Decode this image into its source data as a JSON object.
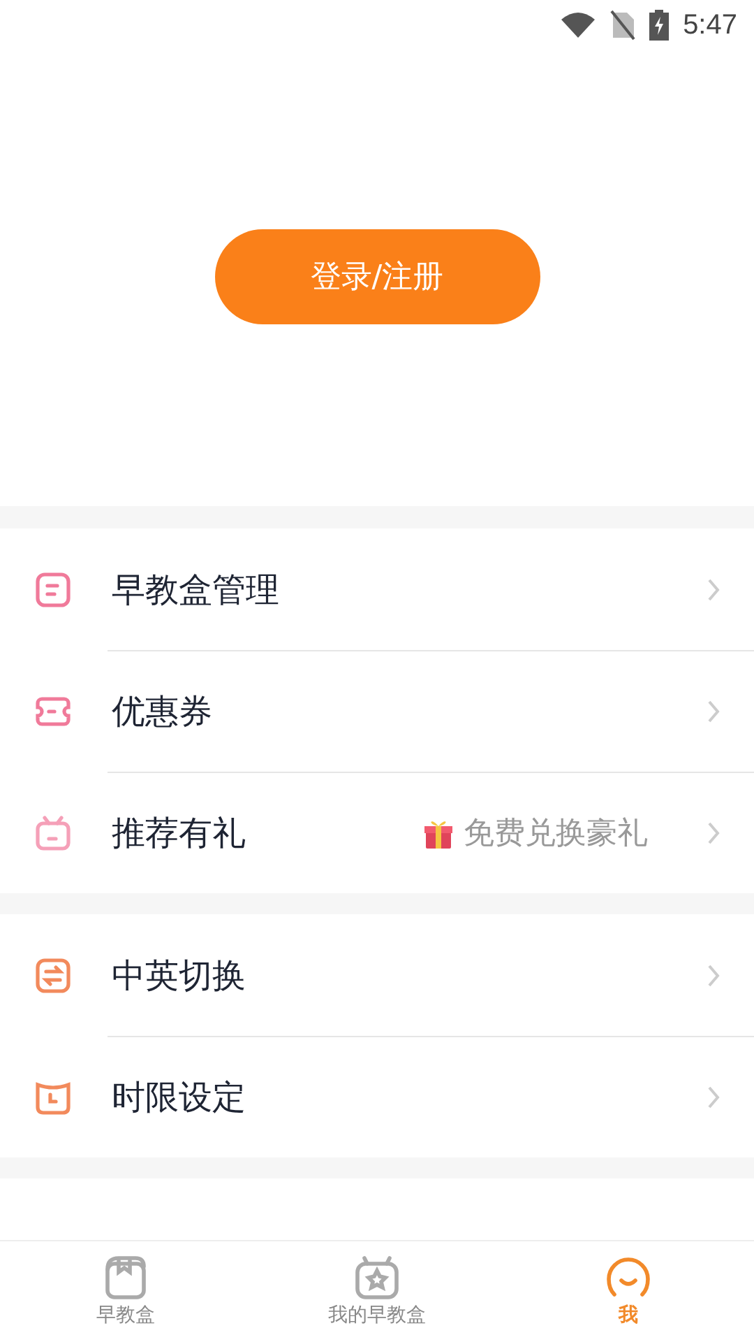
{
  "status_bar": {
    "time": "5:47"
  },
  "login_button": "登录/注册",
  "menu_groups": [
    {
      "items": [
        {
          "label": "早教盒管理",
          "kind": "box"
        },
        {
          "label": "优惠券",
          "kind": "ticket"
        },
        {
          "label": "推荐有礼",
          "kind": "gift",
          "note": "免费兑换豪礼"
        }
      ]
    },
    {
      "items": [
        {
          "label": "中英切换",
          "kind": "switch"
        },
        {
          "label": "时限设定",
          "kind": "clock"
        }
      ]
    }
  ],
  "tab_bar": [
    {
      "label": "早教盒",
      "kind": "box",
      "selected": false
    },
    {
      "label": "我的早教盒",
      "kind": "star",
      "selected": false
    },
    {
      "label": "我",
      "kind": "face",
      "selected": true
    }
  ]
}
